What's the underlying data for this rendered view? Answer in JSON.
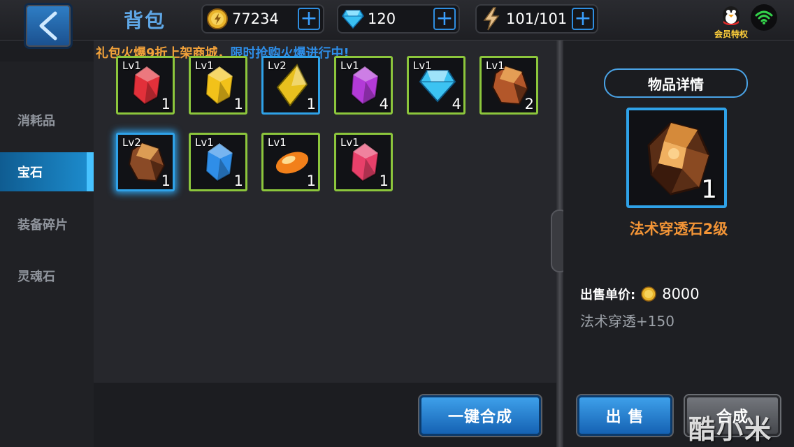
{
  "header": {
    "title": "背包",
    "resources": [
      {
        "name": "gold",
        "value": "77234"
      },
      {
        "name": "diamond",
        "value": "120"
      },
      {
        "name": "energy",
        "value": "101/101"
      }
    ],
    "vip_label": "会员特权"
  },
  "marquee": {
    "part1": "礼包火爆9折上架商城，",
    "part2": "限时抢购火爆进行中!"
  },
  "sidebar": {
    "items": [
      {
        "label": "消耗品",
        "active": false
      },
      {
        "label": "宝石",
        "active": true
      },
      {
        "label": "装备碎片",
        "active": false
      },
      {
        "label": "灵魂石",
        "active": false
      }
    ]
  },
  "inventory": {
    "slots": [
      {
        "level": "Lv1",
        "count": "1",
        "gem": "red-crystal-gem",
        "color": "#e2303a",
        "frame": "green"
      },
      {
        "level": "Lv1",
        "count": "1",
        "gem": "yellow-crystal-gem",
        "color": "#f2c21a",
        "frame": "green"
      },
      {
        "level": "Lv2",
        "count": "1",
        "gem": "yellow-shard-gem",
        "color": "#e8c01e",
        "frame": "blue"
      },
      {
        "level": "Lv1",
        "count": "4",
        "gem": "purple-crystal-gem",
        "color": "#b33ad8",
        "frame": "green"
      },
      {
        "level": "Lv1",
        "count": "4",
        "gem": "cyan-diamond-gem",
        "color": "#3cc3f2",
        "frame": "green"
      },
      {
        "level": "Lv1",
        "count": "2",
        "gem": "brown-ore-gem",
        "color": "#b3572a",
        "frame": "green"
      },
      {
        "level": "Lv2",
        "count": "1",
        "gem": "dark-ore-gem",
        "color": "#8a4a26",
        "frame": "selected"
      },
      {
        "level": "Lv1",
        "count": "1",
        "gem": "blue-crystal-gem",
        "color": "#2f8ee8",
        "frame": "green"
      },
      {
        "level": "Lv1",
        "count": "1",
        "gem": "orange-orb-gem",
        "color": "#f2801a",
        "frame": "green"
      },
      {
        "level": "Lv1",
        "count": "1",
        "gem": "pink-crystal-gem",
        "color": "#e8406a",
        "frame": "green"
      }
    ]
  },
  "detail": {
    "title": "物品详情",
    "count": "1",
    "name": "法术穿透石2级",
    "price_label": "出售单价:",
    "price": "8000",
    "attribute": "法术穿透+150"
  },
  "buttons": {
    "combine_all": "一键合成",
    "sell": "出 售",
    "combine": "合成"
  },
  "watermark": "酷小米",
  "colors": {
    "accent_blue": "#2fa2e8",
    "frame_green": "#8cc63c",
    "item_name": "#f29436",
    "title_blue": "#5fa7e6"
  }
}
